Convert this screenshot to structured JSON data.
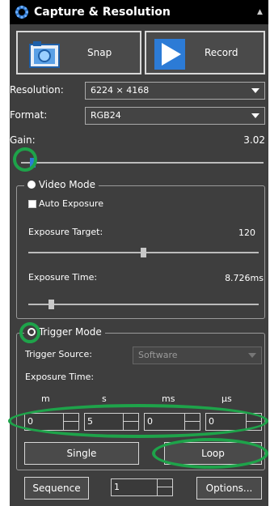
{
  "panel": {
    "title": "Capture & Resolution",
    "collapse_glyph": "▲",
    "title_icon": "capture-gear-icon"
  },
  "capture": {
    "snap_label": "Snap",
    "record_label": "Record"
  },
  "resolution": {
    "label": "Resolution:",
    "value": "6224 × 4168"
  },
  "format": {
    "label": "Format:",
    "value": "RGB24"
  },
  "gain": {
    "label": "Gain:",
    "value": "3.02",
    "slider_position": 0.04
  },
  "video_mode": {
    "label": "Video Mode",
    "selected": true,
    "auto_exposure": {
      "label": "Auto Exposure",
      "checked": false
    },
    "exposure_target": {
      "label": "Exposure Target:",
      "value": "120",
      "slider_position": 0.5
    },
    "exposure_time": {
      "label": "Exposure Time:",
      "value": "8.726ms",
      "slider_position": 0.1
    }
  },
  "trigger_mode": {
    "label": "Trigger Mode",
    "selected": false,
    "source_label": "Trigger Source:",
    "source_value": "Software",
    "exposure_time_label": "Exposure Time:",
    "units": [
      "m",
      "s",
      "ms",
      "µs"
    ],
    "values": [
      "0",
      "5",
      "0",
      "0"
    ],
    "single_label": "Single",
    "loop_label": "Loop"
  },
  "footer": {
    "sequence_label": "Sequence",
    "sequence_value": "1",
    "options_label": "Options..."
  },
  "colors": {
    "panel_bg": "#3e3e3e",
    "highlight": "#1ea34a",
    "record_blue": "#2c7bd6"
  }
}
